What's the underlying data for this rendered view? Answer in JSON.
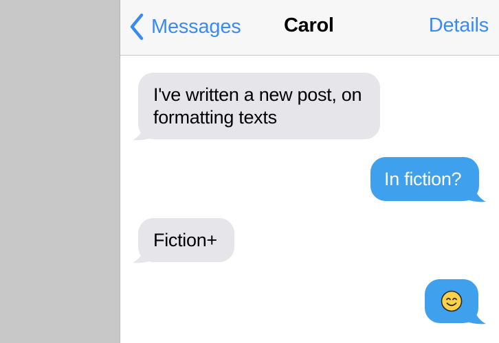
{
  "nav": {
    "back_label": "Messages",
    "title": "Carol",
    "details_label": "Details",
    "back_icon": "chevron-left-icon"
  },
  "messages": [
    {
      "direction": "incoming",
      "text": "I've written a new post, on formatting texts"
    },
    {
      "direction": "outgoing",
      "text": "In fiction?"
    },
    {
      "direction": "incoming",
      "text": "Fiction+"
    },
    {
      "direction": "outgoing",
      "emoji": "smiling-face-icon"
    }
  ],
  "colors": {
    "accent": "#3a8bf0",
    "incoming_bubble": "#e5e5ea",
    "outgoing_bubble": "#3fa0ee",
    "sidebar": "#c8c8c8"
  }
}
